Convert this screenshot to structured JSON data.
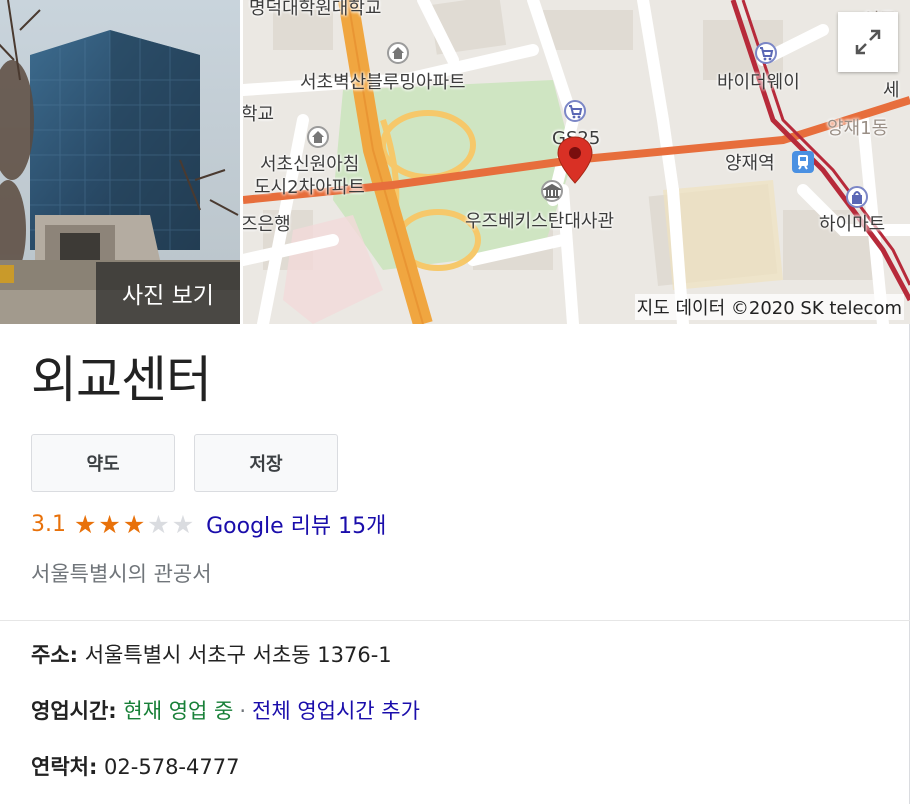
{
  "photo": {
    "view_label": "사진 보기"
  },
  "map": {
    "labels": {
      "university": "명덕대학원대학교",
      "apt1": "서초벽산블루밍아파트",
      "school": "학교",
      "gs25": "GS25",
      "apt2_line1": "서초신원아침",
      "apt2_line2": "도시2차아파트",
      "bank": "즈은행",
      "embassy": "우즈베키스탄대사관",
      "biyway": "바이더웨이",
      "station": "양재역",
      "himart": "하이마트",
      "yangjae1": "양재1동",
      "se": "세",
      "top_right": "언주"
    },
    "attribution": "지도 데이터 ©2020 SK telecom",
    "expand_icon": "expand-icon"
  },
  "place": {
    "name": "외교센터",
    "rating": "3.1",
    "rating_value": 3.1,
    "stars_filled": 3,
    "stars_total": 5,
    "reviews_link": "Google 리뷰 15개",
    "category": "서울특별시의 관공서"
  },
  "actions": {
    "directions": "약도",
    "save": "저장"
  },
  "details": {
    "address_key": "주소:",
    "address_val": "서울특별시 서초구 서초동 1376-1",
    "hours_key": "영업시간:",
    "hours_status": "현재 영업 중",
    "hours_sep": "·",
    "hours_link": "전체 영업시간 추가",
    "phone_key": "연락처:",
    "phone_val": "02-578-4777"
  },
  "colors": {
    "rating_orange": "#e8710a",
    "link_blue": "#1a0dab",
    "open_green": "#188038",
    "pin_red": "#d93025"
  }
}
